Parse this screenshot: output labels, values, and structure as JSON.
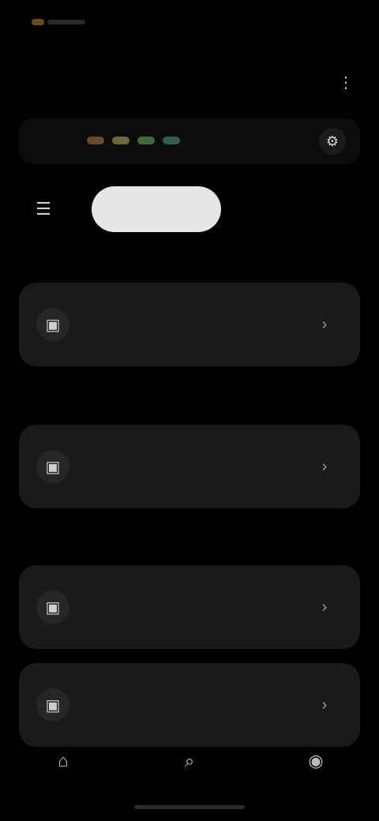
{
  "status_bar": {
    "time": "",
    "battery": ""
  },
  "header": {
    "title": "",
    "action_icon": "more-icon"
  },
  "banner": {
    "text": "",
    "dot_colors": [
      "#6b4a2b",
      "#6e6a34",
      "#3f6b3a",
      "#2f5d4f"
    ],
    "icon": "settings-icon"
  },
  "filter": {
    "icon": "sort-icon",
    "pill_label": ""
  },
  "sections": [
    {
      "label": "",
      "cards": [
        {
          "title": "",
          "subtitle": "",
          "icon": "device-icon",
          "action": "chevron-right-icon"
        }
      ]
    },
    {
      "label": "",
      "cards": [
        {
          "title": "",
          "subtitle": "",
          "icon": "device-icon",
          "action": "chevron-right-icon"
        }
      ]
    },
    {
      "label": "",
      "cards": [
        {
          "title": "",
          "subtitle": "",
          "icon": "device-icon",
          "action": "chevron-right-icon"
        },
        {
          "title": "",
          "subtitle": "",
          "icon": "device-icon",
          "action": "chevron-right-icon"
        }
      ]
    }
  ],
  "bottom_nav": [
    {
      "icon": "home-icon"
    },
    {
      "icon": "search-icon"
    },
    {
      "icon": "profile-icon"
    }
  ],
  "colors": {
    "background": "#000000",
    "card": "#1a1a1a",
    "pill": "#e6e6e6"
  }
}
